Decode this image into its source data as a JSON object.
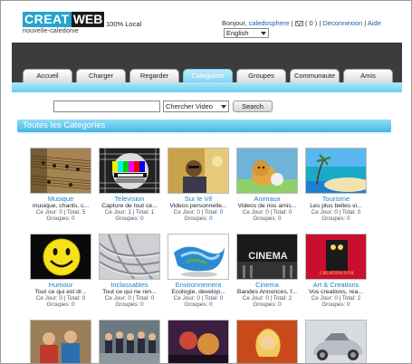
{
  "header": {
    "logo_main": "CREAT",
    "logo_accent": "WEB",
    "logo_sub": "nouvelle-caledonie",
    "local_label": "100% Local",
    "greeting": "Bonjour,",
    "username": "caledosphere",
    "messages_count": "( 0 )",
    "logout": "Deconnexion",
    "help": "Aide",
    "language": "English"
  },
  "nav": {
    "tabs": [
      {
        "label": "Accueil",
        "active": false
      },
      {
        "label": "Charger",
        "active": false
      },
      {
        "label": "Regarder",
        "active": false
      },
      {
        "label": "Categories",
        "active": true
      },
      {
        "label": "Groupes",
        "active": false
      },
      {
        "label": "Communaute",
        "active": false
      },
      {
        "label": "Amis",
        "active": false
      }
    ]
  },
  "search": {
    "value": "",
    "select_value": "Chercher Video",
    "button": "Search"
  },
  "section_title": "Toutes les Categories",
  "categories": [
    {
      "title": "Musique",
      "desc": "musique, chants, c...",
      "ce_jour_label": "Ce Jour:",
      "ce_jour": "0",
      "total_label": "Total:",
      "total": "5",
      "groupes_label": "Groupes:",
      "groupes": "0"
    },
    {
      "title": "Television",
      "desc": "Capture de tout ce...",
      "ce_jour_label": "Ce Jour:",
      "ce_jour": "1",
      "total_label": "Total:",
      "total": "1",
      "groupes_label": "Groupes:",
      "groupes": "0"
    },
    {
      "title": "Sur le Vif",
      "desc": "Videos personnelle...",
      "ce_jour_label": "Ce Jour:",
      "ce_jour": "0",
      "total_label": "Total:",
      "total": "0",
      "groupes_label": "Groupes:",
      "groupes": "0"
    },
    {
      "title": "Animaux",
      "desc": "Videos de nos amis...",
      "ce_jour_label": "Ce Jour:",
      "ce_jour": "0",
      "total_label": "Total:",
      "total": "0",
      "groupes_label": "Groupes:",
      "groupes": "0"
    },
    {
      "title": "Tourisme",
      "desc": "Les plus belles vi...",
      "ce_jour_label": "Ce Jour:",
      "ce_jour": "0",
      "total_label": "Total:",
      "total": "0",
      "groupes_label": "Groupes:",
      "groupes": "0"
    },
    {
      "title": "Humour",
      "desc": "Tout ce qui est dr...",
      "ce_jour_label": "Ce Jour:",
      "ce_jour": "0",
      "total_label": "Total:",
      "total": "0",
      "groupes_label": "Groupes:",
      "groupes": "0"
    },
    {
      "title": "Inclassables",
      "desc": "Tout ce qui ne ren...",
      "ce_jour_label": "Ce Jour:",
      "ce_jour": "0",
      "total_label": "Total:",
      "total": "0",
      "groupes_label": "Groupes:",
      "groupes": "0"
    },
    {
      "title": "Environnement",
      "desc": "Ecologie, develop...",
      "ce_jour_label": "Ce Jour:",
      "ce_jour": "0",
      "total_label": "Total:",
      "total": "0",
      "groupes_label": "Groupes:",
      "groupes": "0"
    },
    {
      "title": "Cinema",
      "desc": "Bandes Annonces, f...",
      "ce_jour_label": "Ce Jour:",
      "ce_jour": "0",
      "total_label": "Total:",
      "total": "2",
      "groupes_label": "Groupes:",
      "groupes": "0"
    },
    {
      "title": "Art & Creations",
      "desc": "Vos creations, rea...",
      "ce_jour_label": "Ce Jour:",
      "ce_jour": "0",
      "total_label": "Total:",
      "total": "2",
      "groupes_label": "Groupes:",
      "groupes": "0"
    }
  ],
  "thumbs": {
    "cinema_text": "CINEMA",
    "art_text": "CREATION D'OR"
  },
  "colors": {
    "accent": "#27a4d0",
    "nav_dark": "#3c3c3c",
    "link": "#1b7fc4",
    "tab_active": "#7fd4f4"
  }
}
